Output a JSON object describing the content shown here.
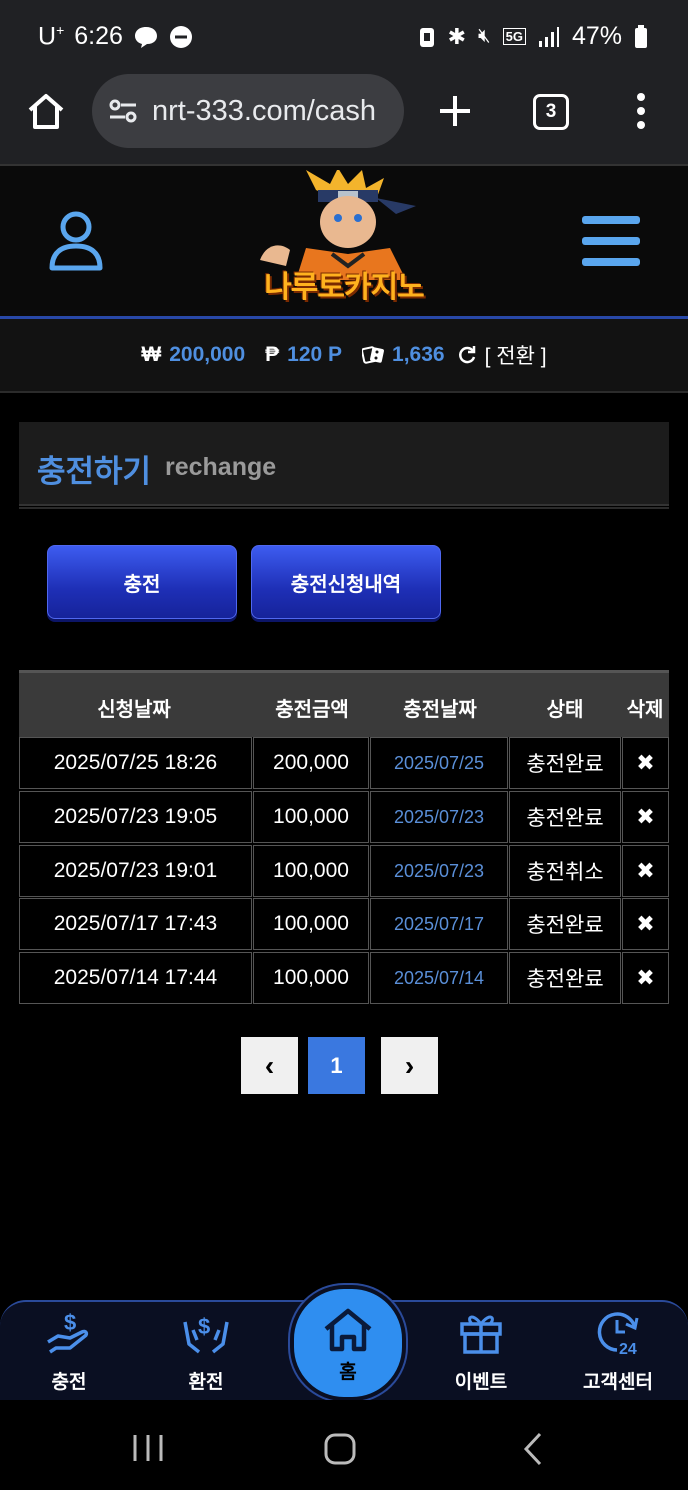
{
  "status_bar": {
    "carrier": "U",
    "carrier_sup": "+",
    "time": "6:26",
    "network": "5G",
    "battery": "47%"
  },
  "browser": {
    "url": "nrt-333.com/cash",
    "tab_count": "3"
  },
  "site": {
    "logo_text": "나루토카지노"
  },
  "balance": {
    "won_symbol": "₩",
    "won_value": "200,000",
    "point_symbol": "₱",
    "point_value": "120 P",
    "casino_value": "1,636",
    "convert_label": "[ 전환 ]"
  },
  "page": {
    "title_ko": "충전하기",
    "title_en": "rechange",
    "charge_button": "충전",
    "history_button": "충전신청내역"
  },
  "table": {
    "headers": [
      "신청날짜",
      "충전금액",
      "충전날짜",
      "상태",
      "삭제"
    ],
    "rows": [
      {
        "request_date": "2025/07/25 18:26",
        "amount": "200,000",
        "charge_date": "2025/07/25",
        "status": "충전완료",
        "delete": "✖"
      },
      {
        "request_date": "2025/07/23 19:05",
        "amount": "100,000",
        "charge_date": "2025/07/23",
        "status": "충전완료",
        "delete": "✖"
      },
      {
        "request_date": "2025/07/23 19:01",
        "amount": "100,000",
        "charge_date": "2025/07/23",
        "status": "충전취소",
        "delete": "✖"
      },
      {
        "request_date": "2025/07/17 17:43",
        "amount": "100,000",
        "charge_date": "2025/07/17",
        "status": "충전완료",
        "delete": "✖"
      },
      {
        "request_date": "2025/07/14 17:44",
        "amount": "100,000",
        "charge_date": "2025/07/14",
        "status": "충전완료",
        "delete": "✖"
      }
    ]
  },
  "pagination": {
    "prev": "‹",
    "current": "1",
    "next": "›"
  },
  "bottom_nav": {
    "items": [
      {
        "label": "충전",
        "icon": "charge-icon"
      },
      {
        "label": "환전",
        "icon": "exchange-icon"
      },
      {
        "label": "홈",
        "icon": "home-icon"
      },
      {
        "label": "이벤트",
        "icon": "gift-icon"
      },
      {
        "label": "고객센터",
        "icon": "support-24-icon"
      }
    ]
  },
  "colors": {
    "accent_blue": "#4f8fe0",
    "button_blue": "#1e2fb6",
    "home_blue": "#2f8ef0"
  }
}
